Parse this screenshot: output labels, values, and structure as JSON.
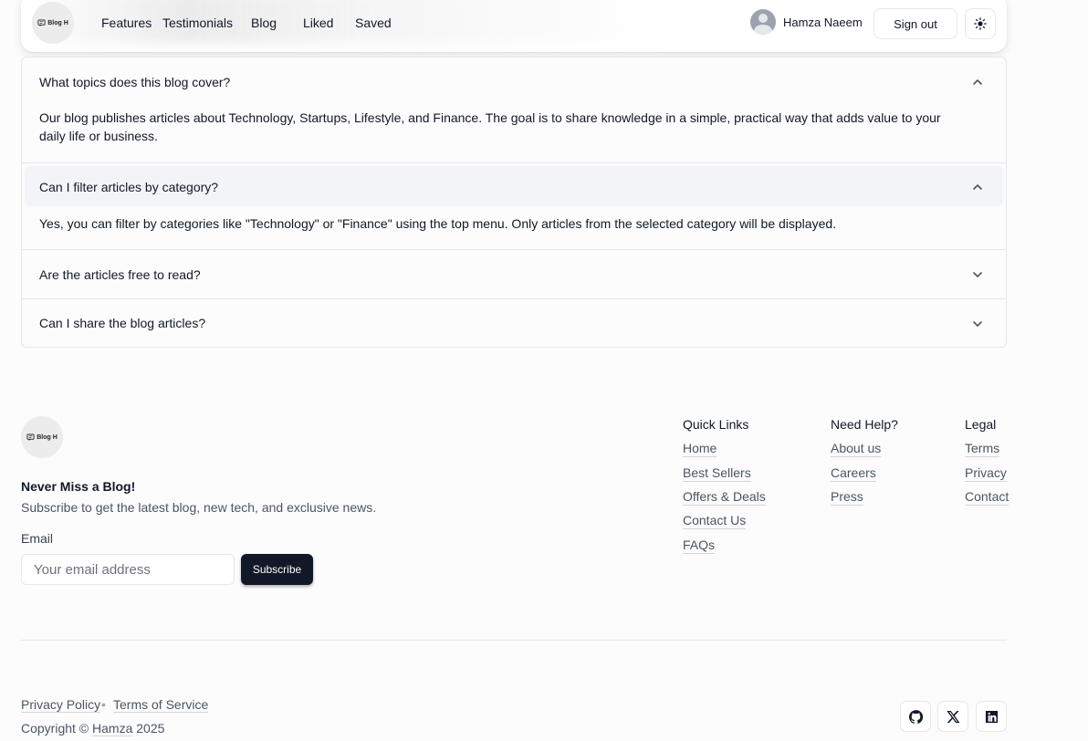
{
  "nav": {
    "logo_text": "Blog H",
    "links": [
      "Features",
      "Testimonials",
      "Blog",
      "Liked",
      "Saved"
    ],
    "user_name": "Hamza Naeem",
    "signout_label": "Sign out",
    "theme_icon": "sun-icon"
  },
  "faq": [
    {
      "question": "What topics does this blog cover?",
      "answer": "Our blog publishes articles about Technology, Startups, Lifestyle, and Finance. The goal is to share knowledge in a simple, practical way that adds value to your daily life or business.",
      "expanded": true
    },
    {
      "question": "Can I filter articles by category?",
      "answer": "Yes, you can filter by categories like \"Technology\" or \"Finance\" using the top menu. Only articles from the selected category will be displayed.",
      "expanded": true
    },
    {
      "question": "Are the articles free to read?",
      "answer": "",
      "expanded": false
    },
    {
      "question": "Can I share the blog articles?",
      "answer": "",
      "expanded": false
    }
  ],
  "footer": {
    "logo_text": "Blog H",
    "title": "Never Miss a Blog!",
    "subtitle": "Subscribe to get the latest blog, new tech, and exclusive news.",
    "email_label": "Email",
    "email_placeholder": "Your email address",
    "subscribe_label": "Subscribe",
    "columns": [
      {
        "heading": "Quick Links",
        "links": [
          "Home",
          "Best Sellers",
          "Offers & Deals",
          "Contact Us",
          "FAQs"
        ]
      },
      {
        "heading": "Need Help?",
        "links": [
          "About us",
          "Careers",
          "Press"
        ]
      },
      {
        "heading": "Legal",
        "links": [
          "Terms",
          "Privacy",
          "Contact"
        ]
      }
    ],
    "bottom_links": [
      "Privacy Policy",
      "Terms of Service"
    ],
    "separator": "•",
    "copyright_prefix": "Copyright ©",
    "copyright_name": "Hamza",
    "copyright_year": "2025",
    "social_icons": [
      "github-icon",
      "x-icon",
      "linkedin-icon"
    ]
  }
}
